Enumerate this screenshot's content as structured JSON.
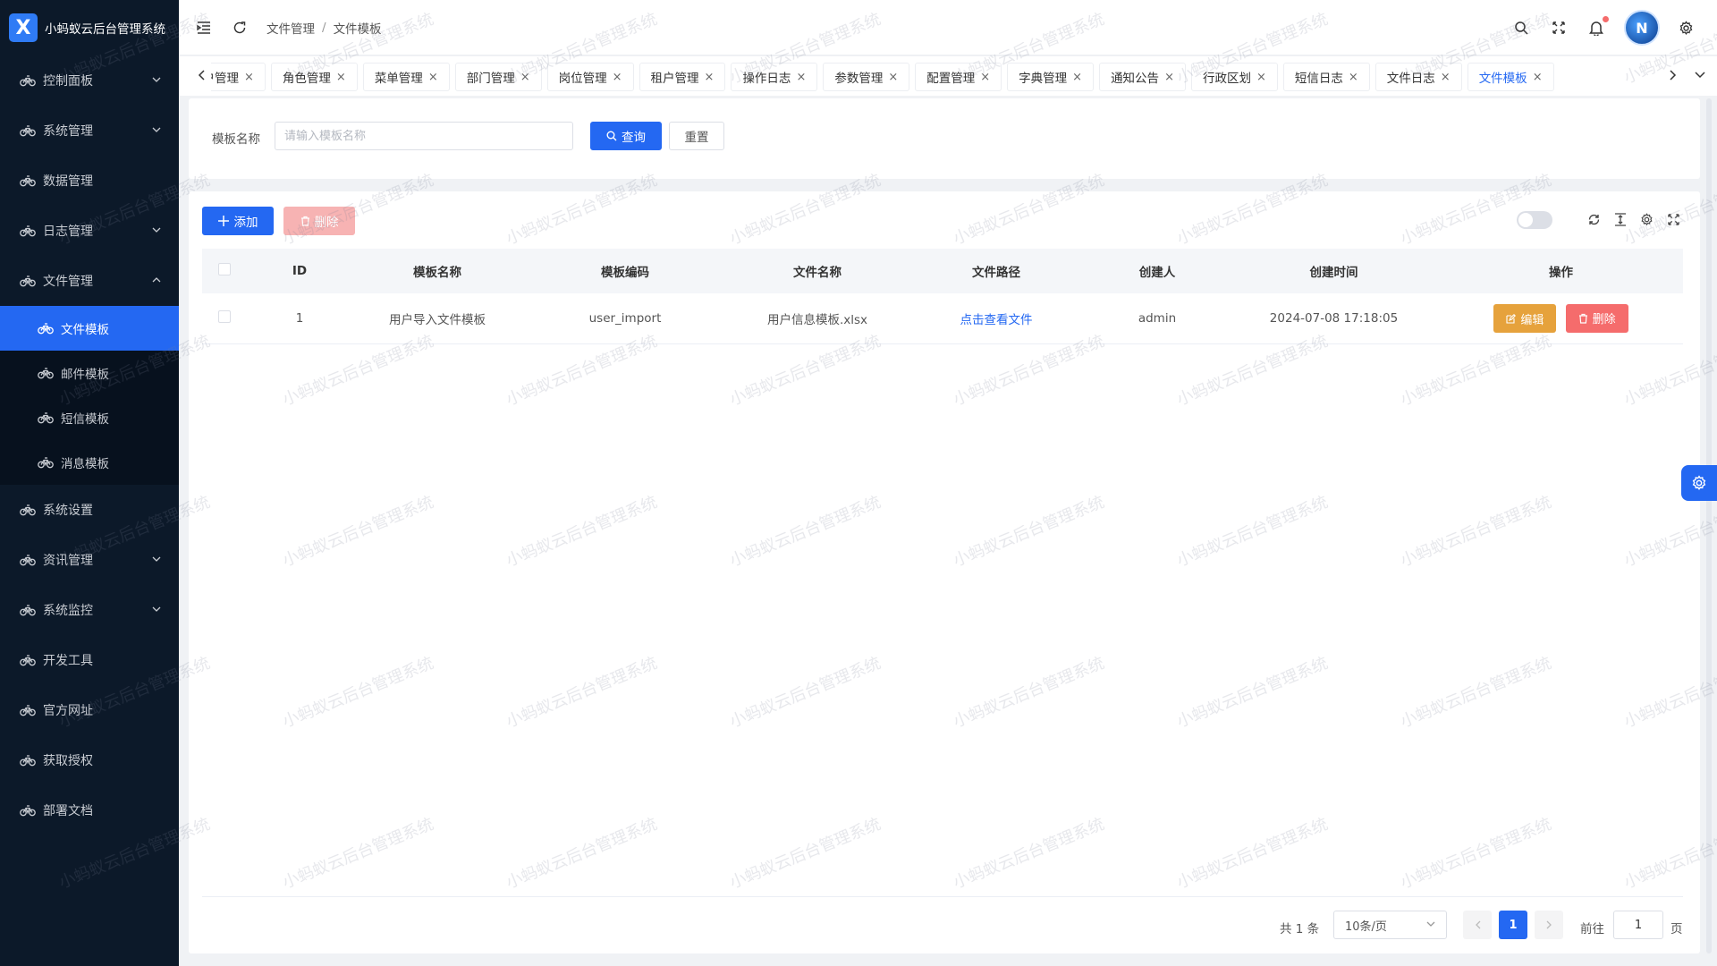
{
  "app": {
    "title": "小蚂蚁云后台管理系统",
    "logo_mark": "X"
  },
  "sidebar": {
    "items": [
      {
        "label": "控制面板",
        "has_children": true,
        "expanded": false
      },
      {
        "label": "系统管理",
        "has_children": true,
        "expanded": false
      },
      {
        "label": "数据管理",
        "has_children": false
      },
      {
        "label": "日志管理",
        "has_children": true,
        "expanded": false
      },
      {
        "label": "文件管理",
        "has_children": true,
        "expanded": true
      },
      {
        "label": "系统设置",
        "has_children": false
      },
      {
        "label": "资讯管理",
        "has_children": true,
        "expanded": false
      },
      {
        "label": "系统监控",
        "has_children": true,
        "expanded": false
      },
      {
        "label": "开发工具",
        "has_children": false
      },
      {
        "label": "官方网址",
        "has_children": false
      },
      {
        "label": "获取授权",
        "has_children": false
      },
      {
        "label": "部署文档",
        "has_children": false
      }
    ],
    "file_sub_items": [
      {
        "label": "文件模板",
        "active": true
      },
      {
        "label": "邮件模板",
        "active": false
      },
      {
        "label": "短信模板",
        "active": false
      },
      {
        "label": "消息模板",
        "active": false
      }
    ]
  },
  "header": {
    "breadcrumb": [
      "文件管理",
      "文件模板"
    ],
    "breadcrumb_sep": "/"
  },
  "tabs": [
    {
      "label": "用户管理",
      "active": false
    },
    {
      "label": "角色管理",
      "active": false
    },
    {
      "label": "菜单管理",
      "active": false
    },
    {
      "label": "部门管理",
      "active": false
    },
    {
      "label": "岗位管理",
      "active": false
    },
    {
      "label": "租户管理",
      "active": false
    },
    {
      "label": "操作日志",
      "active": false
    },
    {
      "label": "参数管理",
      "active": false
    },
    {
      "label": "配置管理",
      "active": false
    },
    {
      "label": "字典管理",
      "active": false
    },
    {
      "label": "通知公告",
      "active": false
    },
    {
      "label": "行政区划",
      "active": false
    },
    {
      "label": "短信日志",
      "active": false
    },
    {
      "label": "文件日志",
      "active": false
    },
    {
      "label": "文件模板",
      "active": true
    }
  ],
  "search": {
    "label": "模板名称",
    "placeholder": "请输入模板名称",
    "query_label": "查询",
    "reset_label": "重置"
  },
  "toolbar": {
    "add_label": "添加",
    "delete_label": "删除"
  },
  "table": {
    "columns": [
      "ID",
      "模板名称",
      "模板编码",
      "文件名称",
      "文件路径",
      "创建人",
      "创建时间",
      "操作"
    ],
    "rows": [
      {
        "id": "1",
        "name": "用户导入文件模板",
        "code": "user_import",
        "file_name": "用户信息模板.xlsx",
        "file_path": "点击查看文件",
        "creator": "admin",
        "created_at": "2024-07-08 17:18:05",
        "edit_label": "编辑",
        "delete_label": "删除"
      }
    ]
  },
  "pagination": {
    "total": "共 1 条",
    "page_size": "10条/页",
    "current_page": "1",
    "goto_label": "前往",
    "goto_value": "1",
    "unit": "页"
  },
  "watermark": {
    "text": "小蚂蚁云后台管理系统"
  },
  "colors": {
    "primary": "#2468f2",
    "sidebar_bg": "#0c1929",
    "warning": "#e6a23c",
    "danger": "#f56c6c"
  }
}
